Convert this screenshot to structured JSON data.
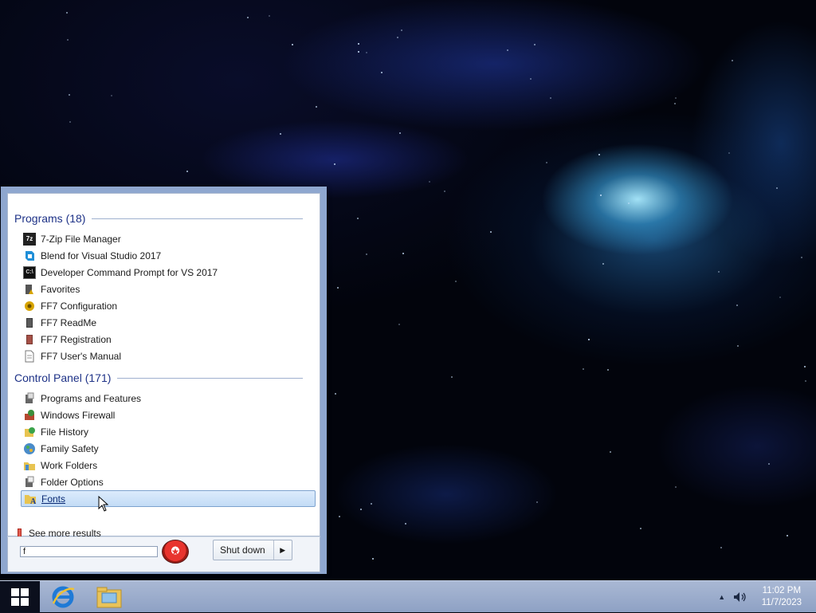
{
  "start_menu": {
    "programs_header": "Programs (18)",
    "programs": [
      {
        "label": "7-Zip File Manager",
        "icon": "7zip-icon"
      },
      {
        "label": "Blend for Visual Studio 2017",
        "icon": "blend-icon"
      },
      {
        "label": "Developer Command Prompt for VS 2017",
        "icon": "cmd-icon"
      },
      {
        "label": "Favorites",
        "icon": "favorites-icon"
      },
      {
        "label": "FF7 Configuration",
        "icon": "ff7-config-icon"
      },
      {
        "label": "FF7 ReadMe",
        "icon": "ff7-readme-icon"
      },
      {
        "label": "FF7 Registration",
        "icon": "ff7-registration-icon"
      },
      {
        "label": "FF7 User's Manual",
        "icon": "document-icon"
      }
    ],
    "control_panel_header": "Control Panel (171)",
    "control_panel": [
      {
        "label": "Programs and Features",
        "icon": "programs-features-icon"
      },
      {
        "label": "Windows Firewall",
        "icon": "firewall-icon"
      },
      {
        "label": "File History",
        "icon": "file-history-icon"
      },
      {
        "label": "Family Safety",
        "icon": "family-safety-icon"
      },
      {
        "label": "Work Folders",
        "icon": "work-folders-icon"
      },
      {
        "label": "Folder Options",
        "icon": "folder-options-icon"
      },
      {
        "label": "Fonts",
        "icon": "fonts-icon",
        "selected": true
      }
    ],
    "see_more": "See more results",
    "search_value": "f",
    "shutdown_label": "Shut down"
  },
  "taskbar": {
    "pinned": [
      "internet-explorer-icon",
      "file-explorer-icon"
    ],
    "clock_time": "11:02 PM",
    "clock_date": "11/7/2023"
  },
  "colors": {
    "menu_frame": "#8fa7cf",
    "section_header": "#1e3287",
    "selection": "#c3dcf6",
    "taskbar": "#9aabcb"
  }
}
